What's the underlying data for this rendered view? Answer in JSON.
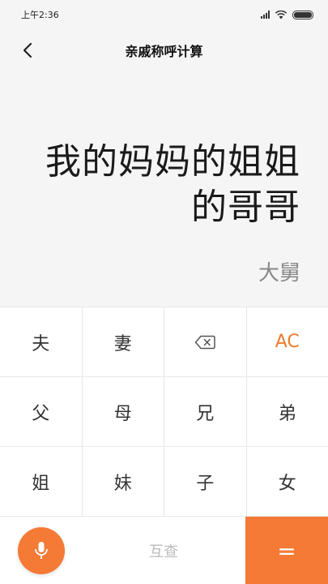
{
  "status_bar": {
    "time": "上午2:36"
  },
  "header": {
    "title": "亲戚称呼计算",
    "back_icon": "chevron-left-icon"
  },
  "display": {
    "expression": "我的妈妈的姐姐的哥哥",
    "result": "大舅"
  },
  "keypad": {
    "rows": [
      [
        "夫",
        "妻",
        "⌫",
        "AC"
      ],
      [
        "父",
        "母",
        "兄",
        "弟"
      ],
      [
        "姐",
        "妹",
        "子",
        "女"
      ]
    ],
    "backspace_icon": "backspace-icon",
    "lookup_label": "互查",
    "equals_label": "=",
    "mic_icon": "microphone-icon"
  },
  "colors": {
    "accent": "#f47a36",
    "ac_text": "#f07a2c",
    "background": "#f5f5f5"
  }
}
